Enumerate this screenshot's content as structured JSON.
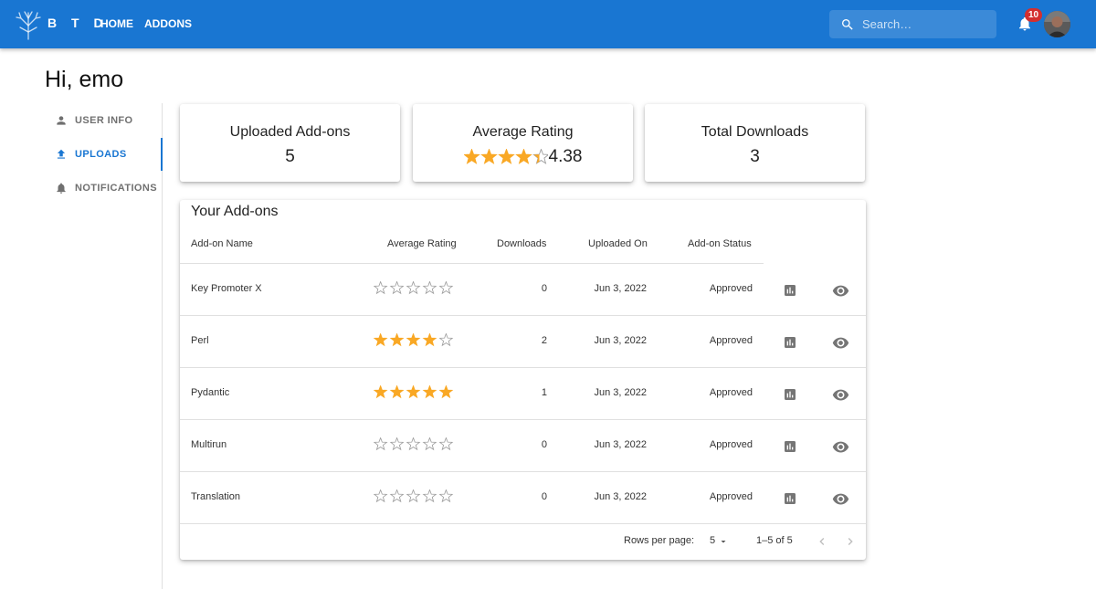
{
  "app": {
    "brand": "B T D",
    "nav": [
      "HOME",
      "ADDONS"
    ],
    "search_placeholder": "Search…",
    "notification_count": "10"
  },
  "colors": {
    "primary": "#1976d2",
    "star": "#f9a825",
    "badge": "#d32f2f"
  },
  "greeting": "Hi, emo",
  "sidebar": {
    "items": [
      {
        "label": "USER INFO",
        "icon": "person-icon",
        "active": false
      },
      {
        "label": "UPLOADS",
        "icon": "upload-icon",
        "active": true
      },
      {
        "label": "NOTIFICATIONS",
        "icon": "bell-icon",
        "active": false
      }
    ]
  },
  "stats": {
    "uploaded": {
      "title": "Uploaded Add-ons",
      "value": "5"
    },
    "rating": {
      "title": "Average Rating",
      "value": "4.38",
      "stars": 4.38
    },
    "downloads": {
      "title": "Total Downloads",
      "value": "3"
    }
  },
  "table": {
    "title": "Your Add-ons",
    "columns": [
      "Add-on Name",
      "Average Rating",
      "Downloads",
      "Uploaded On",
      "Add-on Status"
    ],
    "rows": [
      {
        "name": "Key Promoter X",
        "rating": 0,
        "downloads": "0",
        "uploaded": "Jun 3, 2022",
        "status": "Approved"
      },
      {
        "name": "Perl",
        "rating": 4,
        "downloads": "2",
        "uploaded": "Jun 3, 2022",
        "status": "Approved"
      },
      {
        "name": "Pydantic",
        "rating": 5,
        "downloads": "1",
        "uploaded": "Jun 3, 2022",
        "status": "Approved"
      },
      {
        "name": "Multirun",
        "rating": 0,
        "downloads": "0",
        "uploaded": "Jun 3, 2022",
        "status": "Approved"
      },
      {
        "name": "Translation",
        "rating": 0,
        "downloads": "0",
        "uploaded": "Jun 3, 2022",
        "status": "Approved"
      }
    ],
    "row_actions": [
      "stats-icon",
      "eye-icon"
    ],
    "footer": {
      "rows_per_page_label": "Rows per page:",
      "rows_per_page": "5",
      "range": "1–5 of 5"
    }
  }
}
